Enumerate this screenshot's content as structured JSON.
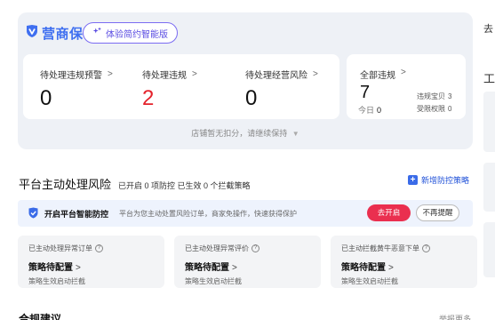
{
  "brand": {
    "name": "营商保",
    "logo_color": "#3f6ff0"
  },
  "promo_pill": {
    "label": "体验简约智能版"
  },
  "stats": [
    {
      "label": "待处理违规预警",
      "value": "0",
      "highlight": false
    },
    {
      "label": "待处理违规",
      "value": "2",
      "highlight": true
    },
    {
      "label": "待处理经营风险",
      "value": "0",
      "highlight": false
    }
  ],
  "total": {
    "label": "全部违规",
    "value": "7",
    "today_label": "今日",
    "today_value": "0",
    "lines": [
      {
        "label": "违规宝贝",
        "value": "3"
      },
      {
        "label": "受限权限",
        "value": "0"
      }
    ]
  },
  "deduct_note": "店铺暂无扣分，请继续保持",
  "section": {
    "title": "平台主动处理风险",
    "subtitle": "已开启 0 项防控 已生效 0 个拦截策略",
    "new_strategy": "新增防控策略"
  },
  "smart_bar": {
    "title": "开启平台智能防控",
    "description": "平台为您主动处置风险订单，商家免操作，快速获得保护",
    "open_label": "去开启",
    "remind_label": "不再提醒"
  },
  "strategy_cards": [
    {
      "title": "已主动处理异常订单",
      "strategy": "策略待配置",
      "note": "策略生效启动拦截"
    },
    {
      "title": "已主动处理异常评价",
      "strategy": "策略待配置",
      "note": "策略生效启动拦截"
    },
    {
      "title": "已主动拦截黄牛恶意下单",
      "strategy": "策略待配置",
      "note": "策略生效启动拦截"
    }
  ],
  "bottom": {
    "heading": "合规建议",
    "more": "举报更多"
  },
  "right_edge": {
    "top_char": "去",
    "mid_char": "工"
  },
  "colors": {
    "accent": "#3a6be8",
    "danger": "#e4222b",
    "open_button": "#ea2f4f",
    "purple": "#5b4de2"
  }
}
